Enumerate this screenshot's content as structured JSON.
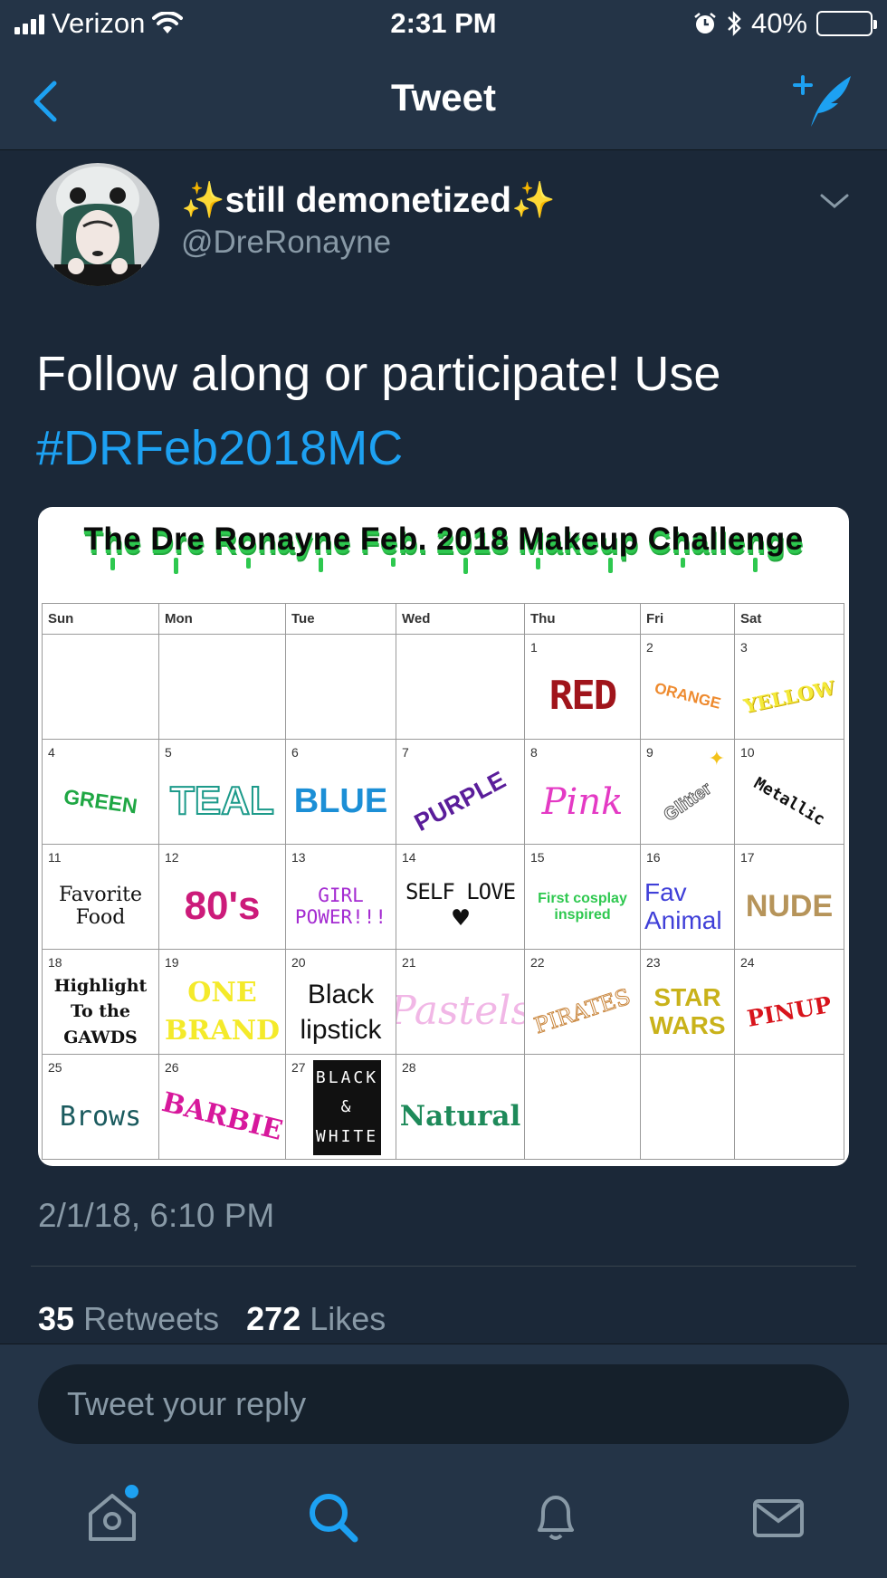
{
  "status_bar": {
    "carrier": "Verizon",
    "time": "2:31 PM",
    "battery": "40%",
    "battery_level": 0.4
  },
  "nav": {
    "title": "Tweet"
  },
  "tweet": {
    "author_name": "still demonetized",
    "author_name_emoji": "✨",
    "handle": "@DreRonayne",
    "text": "Follow along or participate! Use",
    "hashtag": "#DRFeb2018MC",
    "timestamp": "2/1/18, 6:10 PM",
    "retweets": "35",
    "retweets_label": "Retweets",
    "likes": "272",
    "likes_label": "Likes"
  },
  "calendar": {
    "title": "The Dre Ronayne Feb. 2018 Makeup Challenge",
    "weekdays": [
      "Sun",
      "Mon",
      "Tue",
      "Wed",
      "Thu",
      "Fri",
      "Sat"
    ],
    "colors": {
      "title_green": "#2ec84f"
    },
    "weeks": [
      [
        {
          "day": "",
          "text": ""
        },
        {
          "day": "",
          "text": ""
        },
        {
          "day": "",
          "text": ""
        },
        {
          "day": "",
          "text": ""
        },
        {
          "day": "1",
          "text": "RED"
        },
        {
          "day": "2",
          "text": "ORANGE"
        },
        {
          "day": "3",
          "text": "YELLOW"
        }
      ],
      [
        {
          "day": "4",
          "text": "GREEN"
        },
        {
          "day": "5",
          "text": "TEAL"
        },
        {
          "day": "6",
          "text": "BLUE"
        },
        {
          "day": "7",
          "text": "PURPLE"
        },
        {
          "day": "8",
          "text": "Pink"
        },
        {
          "day": "9",
          "text": "Glitter"
        },
        {
          "day": "10",
          "text": "Metallic"
        }
      ],
      [
        {
          "day": "11",
          "text": "Favorite Food"
        },
        {
          "day": "12",
          "text": "80's"
        },
        {
          "day": "13",
          "text": "GIRL POWER!!!"
        },
        {
          "day": "14",
          "text": "SELF LOVE"
        },
        {
          "day": "15",
          "text": "First cosplay inspired"
        },
        {
          "day": "16",
          "text": "Fav Animal"
        },
        {
          "day": "17",
          "text": "NUDE"
        }
      ],
      [
        {
          "day": "18",
          "text": "Highlight To the GAWDS"
        },
        {
          "day": "19",
          "text": "ONE BRAND"
        },
        {
          "day": "20",
          "text": "Black lipstick"
        },
        {
          "day": "21",
          "text": "Pastels"
        },
        {
          "day": "22",
          "text": "PIRATES"
        },
        {
          "day": "23",
          "text": "STAR WARS"
        },
        {
          "day": "24",
          "text": "PINUP"
        }
      ],
      [
        {
          "day": "25",
          "text": "Brows"
        },
        {
          "day": "26",
          "text": "BARBIE"
        },
        {
          "day": "27",
          "text": "BLACK & WHITE"
        },
        {
          "day": "28",
          "text": "Natural"
        },
        {
          "day": "",
          "text": ""
        },
        {
          "day": "",
          "text": ""
        },
        {
          "day": "",
          "text": ""
        }
      ]
    ]
  },
  "reply": {
    "placeholder": "Tweet your reply"
  },
  "tabbar": {
    "items": [
      "home-icon",
      "search-icon",
      "notifications-icon",
      "messages-icon"
    ],
    "active": "search-icon",
    "accent": "#1da1f2"
  }
}
